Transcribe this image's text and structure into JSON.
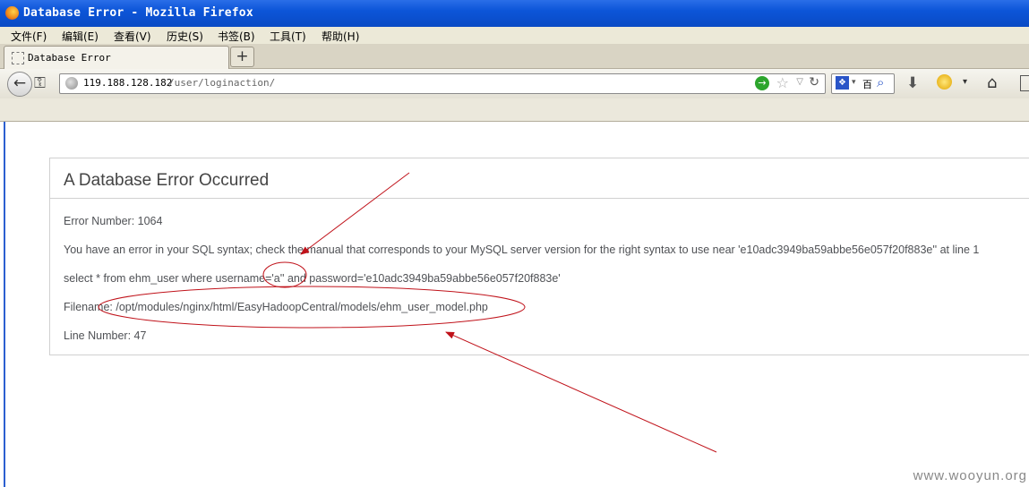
{
  "window": {
    "title": "Database Error - Mozilla Firefox"
  },
  "menubar": {
    "items": [
      "文件(F)",
      "编辑(E)",
      "查看(V)",
      "历史(S)",
      "书签(B)",
      "工具(T)",
      "帮助(H)"
    ]
  },
  "tabs": [
    {
      "label": "Database Error"
    }
  ],
  "new_tab_label": "+",
  "navbar": {
    "url_host": "119.188.128.182",
    "url_path": "/user/loginaction/",
    "search_engine": "百"
  },
  "page": {
    "heading": "A Database Error Occurred",
    "lines": [
      "Error Number: 1064",
      "You have an error in your SQL syntax; check the manual that corresponds to your MySQL server version for the right syntax to use near 'e10adc3949ba59abbe56e057f20f883e'' at line 1",
      "select * from ehm_user where username='a'' and password='e10adc3949ba59abbe56e057f20f883e'",
      "Filename: /opt/modules/nginx/html/EasyHadoopCentral/models/ehm_user_model.php",
      "Line Number: 47"
    ]
  },
  "watermark": "www.wooyun.org",
  "annotation_color": "#c0121a",
  "icons": [
    "firefox-icon",
    "back-arrow-icon",
    "key-icon",
    "globe-icon",
    "go-arrow-icon",
    "star-icon",
    "dropdown-icon",
    "reload-icon",
    "search-engine-icon",
    "magnifier-icon",
    "download-icon",
    "addon-icon",
    "home-icon"
  ]
}
